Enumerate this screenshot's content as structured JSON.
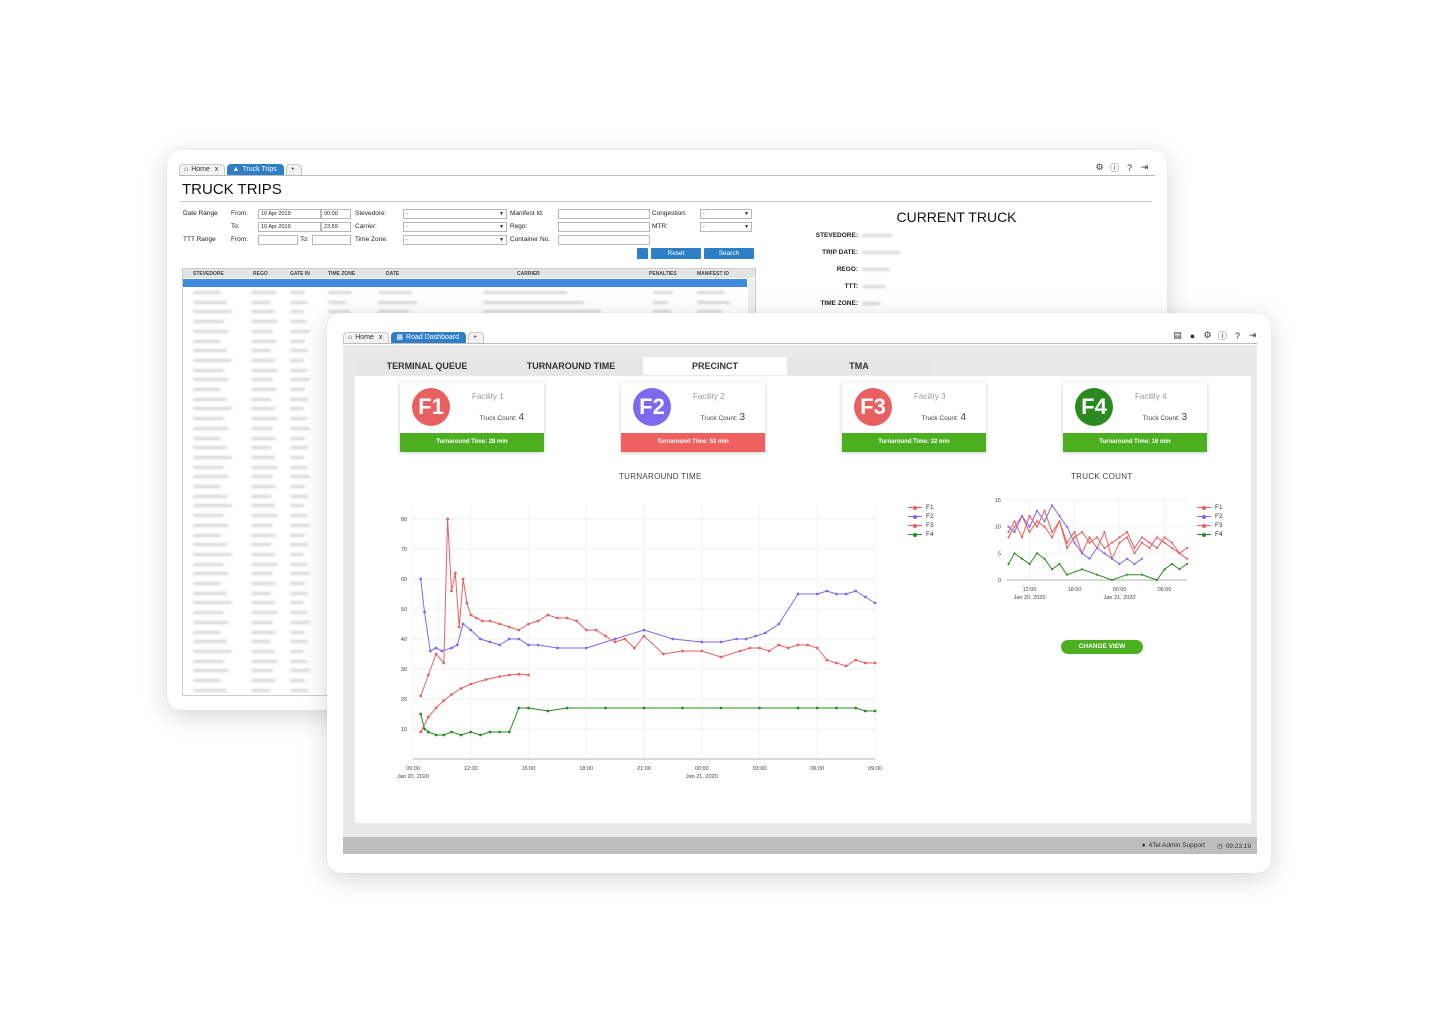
{
  "back_window": {
    "tabs": [
      {
        "label": "Home",
        "close": "x"
      },
      {
        "label": "Truck Trips"
      },
      {
        "label": "+"
      }
    ],
    "page_title": "TRUCK TRIPS",
    "filters": {
      "date_range_label": "Date Range",
      "from_label": "From:",
      "to_label": "To:",
      "date_from": "10 Apr 2019",
      "time_from": "00:00",
      "date_to": "10 Apr 2019",
      "time_to": "23:59",
      "ttt_range_label": "TTT Range",
      "ttt_from_label": "From:",
      "ttt_to_label": "To:",
      "stevedore_label": "Stevedore:",
      "carrier_label": "Carrier:",
      "timezone_label": "Time Zone:",
      "select_default": "-",
      "manifest_label": "Manifest Id:",
      "rego_label": "Rego:",
      "container_label": "Container No.",
      "congestion_label": "Congestion:",
      "mtr_label": "MTR:",
      "reset_label": "Reset",
      "search_label": "Search"
    },
    "table": {
      "columns": [
        "STEVEDORE",
        "REGO",
        "GATE IN",
        "TIME ZONE",
        "DATE",
        "CARRIER",
        "PENALTIES",
        "MANIFEST ID"
      ]
    },
    "current_truck": {
      "title": "CURRENT TRUCK",
      "fields": [
        "STEVEDORE:",
        "TRIP DATE:",
        "REGO:",
        "TTT:",
        "TIME ZONE:"
      ]
    }
  },
  "front_window": {
    "tabs": [
      {
        "label": "Home",
        "close": "x"
      },
      {
        "label": "Road Dashboard"
      },
      {
        "label": "+"
      }
    ],
    "nav_tabs": [
      "TERMINAL QUEUE",
      "TURNAROUND TIME",
      "PRECINCT",
      "TMA"
    ],
    "active_nav": "PRECINCT",
    "facilities": [
      {
        "code": "F1",
        "name": "Facility 1",
        "count_label": "Truck Count:",
        "count": "4",
        "turnaround": "Turnaround Time: 28 min",
        "color": "#e8605f",
        "status_color": "#4caf1f"
      },
      {
        "code": "F2",
        "name": "Facility 2",
        "count_label": "Truck Count:",
        "count": "3",
        "turnaround": "Turnaround Time: 53 min",
        "color": "#7d68f0",
        "status_color": "#f06060"
      },
      {
        "code": "F3",
        "name": "Facility 3",
        "count_label": "Truck Count:",
        "count": "4",
        "turnaround": "Turnaround Time: 32 min",
        "color": "#e8605f",
        "status_color": "#4caf1f"
      },
      {
        "code": "F4",
        "name": "Facility 4",
        "count_label": "Truck Count:",
        "count": "3",
        "turnaround": "Turnaround Time: 16 min",
        "color": "#2a8a1f",
        "status_color": "#4caf1f"
      }
    ],
    "change_view_label": "CHANGE VIEW",
    "footer": {
      "user": "4Tel Admin Support",
      "clock": "09:23:19"
    }
  },
  "chart_data": [
    {
      "type": "line",
      "title": "TURNAROUND TIME",
      "xlabel": "",
      "ylabel": "",
      "x_ticks": [
        "09:00\nJan 20, 2020",
        "12:00",
        "15:00",
        "18:00",
        "21:00",
        "00:00\nJan 21, 2020",
        "03:00",
        "06:00",
        "09:00"
      ],
      "x_range_hours": [
        0,
        24
      ],
      "ylim": [
        0,
        85
      ],
      "y_ticks": [
        10,
        20,
        30,
        40,
        50,
        60,
        70,
        80
      ],
      "legend_position": "right",
      "colors": {
        "F1": "#e8605f",
        "F2": "#7d68f0",
        "F3": "#e8605f",
        "F4": "#2a8a1f"
      },
      "series": [
        {
          "name": "F1",
          "x": [
            0.4,
            0.8,
            1.2,
            1.6,
            2.0,
            2.5,
            3.0,
            3.8,
            4.5,
            5.0,
            5.5,
            6.0
          ],
          "y": [
            9,
            14,
            17,
            19.5,
            21.5,
            23.5,
            25,
            26.5,
            27.5,
            28,
            28.3,
            28
          ]
        },
        {
          "name": "F2",
          "x": [
            0.4,
            0.6,
            0.9,
            1.2,
            1.5,
            2.0,
            2.3,
            2.6,
            3.0,
            3.5,
            4.0,
            4.5,
            5.0,
            5.5,
            6.0,
            6.5,
            7.5,
            9.0,
            10.5,
            12.0,
            13.5,
            15.0,
            16.0,
            16.8,
            17.3,
            17.8,
            18.3,
            19.0,
            20.0,
            21.0,
            21.5,
            22.0,
            22.5,
            23.0,
            23.5,
            24.0
          ],
          "y": [
            60,
            49,
            36,
            37,
            36,
            37,
            38,
            45,
            43,
            40,
            39,
            38,
            40,
            40,
            38,
            38,
            37,
            37,
            40,
            43,
            40,
            39,
            39,
            40,
            40,
            41,
            42,
            45,
            55,
            55,
            56,
            55,
            55,
            56,
            54,
            52
          ]
        },
        {
          "name": "F3",
          "x": [
            0.4,
            0.8,
            1.2,
            1.6,
            1.8,
            2.0,
            2.2,
            2.4,
            2.6,
            2.8,
            3.0,
            3.3,
            3.6,
            4.0,
            4.5,
            5.0,
            5.5,
            6.0,
            6.5,
            7.0,
            7.5,
            8.0,
            8.5,
            9.0,
            9.5,
            10.0,
            10.5,
            11.0,
            11.5,
            12.0,
            13.0,
            14.0,
            15.0,
            16.0,
            17.0,
            17.5,
            18.0,
            18.5,
            19.0,
            19.5,
            20.0,
            20.5,
            21.0,
            21.5,
            22.0,
            22.5,
            23.0,
            23.5,
            24.0
          ],
          "y": [
            21,
            28,
            35,
            32,
            80,
            56,
            62,
            44,
            60,
            52,
            48,
            47,
            46,
            46,
            45,
            44,
            43,
            45,
            46,
            48,
            47,
            47,
            46,
            43,
            43,
            41,
            39,
            40,
            37,
            41,
            35,
            36,
            36,
            34,
            36,
            37,
            37,
            36,
            38,
            37,
            38,
            38,
            37,
            33,
            32,
            31,
            33,
            32,
            32
          ]
        },
        {
          "name": "F4",
          "x": [
            0.4,
            0.6,
            0.8,
            1.2,
            1.6,
            2.0,
            2.5,
            3.0,
            3.5,
            4.0,
            4.5,
            5.0,
            5.5,
            6.0,
            7.0,
            8.0,
            10.0,
            12.0,
            14.0,
            16.0,
            18.0,
            20.0,
            21.0,
            22.0,
            23.0,
            23.5,
            24.0
          ],
          "y": [
            15,
            10,
            9,
            8,
            8,
            9,
            8,
            9,
            8,
            9,
            9,
            9,
            17,
            17,
            16,
            17,
            17,
            17,
            17,
            17,
            17,
            17,
            17,
            17,
            17,
            16,
            16
          ]
        }
      ]
    },
    {
      "type": "line",
      "title": "TRUCK COUNT",
      "xlabel": "",
      "ylabel": "",
      "x_ticks": [
        "12:00\nJan 20, 2020",
        "18:00",
        "00:00\nJan 21, 2020",
        "06:00"
      ],
      "x_range_hours": [
        0,
        24
      ],
      "ylim": [
        0,
        15
      ],
      "y_ticks": [
        0,
        5,
        10,
        15
      ],
      "legend_position": "right",
      "colors": {
        "F1": "#e8605f",
        "F2": "#7d68f0",
        "F3": "#e8605f",
        "F4": "#2a8a1f"
      },
      "series": [
        {
          "name": "F1",
          "x": [
            0.2,
            1.0,
            2.0,
            3.0,
            4.0,
            5.0,
            6.0,
            7.0,
            8.0,
            9.0,
            10.0,
            11.0,
            12.0,
            13.0,
            14.0,
            15.0,
            16.0,
            17.0,
            18.0,
            19.0,
            20.0,
            21.0,
            22.0,
            23.0,
            24.0
          ],
          "y": [
            9,
            11,
            8,
            12,
            10,
            13,
            9,
            11,
            7,
            9,
            5,
            8,
            6,
            9,
            4,
            7,
            8,
            5,
            7,
            6,
            8,
            7,
            6,
            5,
            4
          ]
        },
        {
          "name": "F2",
          "x": [
            0.2,
            1.0,
            2.0,
            3.0,
            4.0,
            5.0,
            6.0,
            7.0,
            8.0,
            9.0,
            10.0,
            11.0,
            12.0,
            13.0,
            14.0,
            15.0,
            16.0,
            17.0,
            18.0
          ],
          "y": [
            10,
            9,
            12,
            10,
            13,
            11,
            14,
            12,
            10,
            7,
            5,
            4,
            6,
            5,
            4,
            3,
            4,
            3,
            4
          ]
        },
        {
          "name": "F3",
          "x": [
            0.2,
            1.0,
            2.0,
            3.0,
            4.0,
            5.0,
            6.0,
            7.0,
            8.0,
            9.0,
            10.0,
            11.0,
            12.0,
            13.0,
            14.0,
            15.0,
            16.0,
            17.0,
            18.0,
            19.0,
            20.0,
            21.0,
            22.0,
            23.0,
            24.0
          ],
          "y": [
            8,
            10,
            12,
            9,
            11,
            10,
            8,
            11,
            6,
            8,
            9,
            7,
            8,
            6,
            7,
            8,
            9,
            6,
            8,
            7,
            6,
            8,
            7,
            5,
            6
          ]
        },
        {
          "name": "F4",
          "x": [
            0.2,
            1.0,
            2.0,
            3.0,
            4.0,
            5.0,
            6.0,
            7.0,
            8.0,
            10.0,
            12.0,
            14.0,
            16.0,
            18.0,
            20.0,
            21.0,
            22.0,
            23.0,
            24.0
          ],
          "y": [
            3,
            5,
            4,
            3,
            5,
            4,
            2,
            3,
            1,
            2,
            1,
            0,
            1,
            1,
            0,
            2,
            3,
            2,
            3
          ]
        }
      ]
    }
  ]
}
